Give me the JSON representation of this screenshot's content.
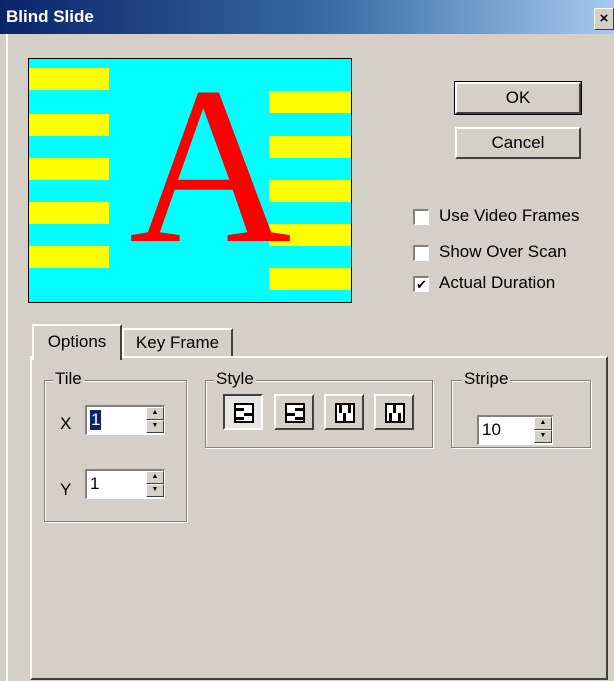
{
  "window": {
    "title": "Blind Slide",
    "close_glyph": "×"
  },
  "preview": {
    "letter": "A",
    "colors": {
      "background": "#00ffff",
      "stripes": "#ffff00",
      "letter": "#ff0000"
    }
  },
  "buttons": {
    "ok": "OK",
    "cancel": "Cancel"
  },
  "checkboxes": [
    {
      "label": "Use Video Frames",
      "checked": false
    },
    {
      "label": "Show Over Scan",
      "checked": false
    },
    {
      "label": "Actual Duration",
      "checked": true
    }
  ],
  "tabs": [
    {
      "label": "Options",
      "selected": true
    },
    {
      "label": "Key Frame",
      "selected": false
    }
  ],
  "tile": {
    "title": "Tile",
    "x_label": "X",
    "x_value": "1",
    "y_label": "Y",
    "y_value": "1"
  },
  "style": {
    "title": "Style",
    "buttons": [
      {
        "icon": "blind-style-1-icon",
        "pressed": true
      },
      {
        "icon": "blind-style-2-icon",
        "pressed": false
      },
      {
        "icon": "blind-style-3-icon",
        "pressed": false
      },
      {
        "icon": "blind-style-4-icon",
        "pressed": false
      }
    ]
  },
  "stripe": {
    "title": "Stripe",
    "value": "10"
  }
}
